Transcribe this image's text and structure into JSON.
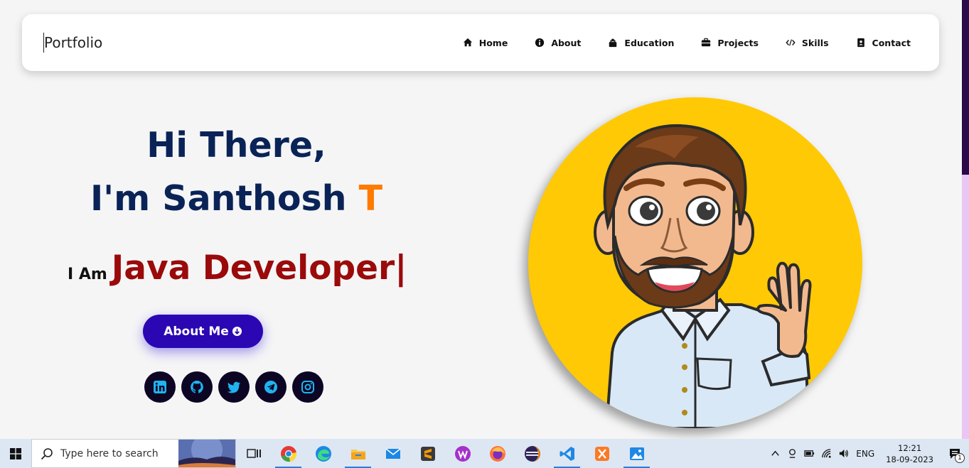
{
  "navbar": {
    "brand": "Portfolio",
    "items": [
      {
        "label": "Home",
        "icon": "home-icon"
      },
      {
        "label": "About",
        "icon": "info-icon"
      },
      {
        "label": "Education",
        "icon": "graduation-icon"
      },
      {
        "label": "Projects",
        "icon": "briefcase-icon"
      },
      {
        "label": "Skills",
        "icon": "code-icon"
      },
      {
        "label": "Contact",
        "icon": "address-book-icon"
      }
    ]
  },
  "hero": {
    "line1": "Hi There,",
    "line2_prefix": "I'm Santhosh ",
    "line2_accent": "T",
    "iam_label": "I Am",
    "iam_role": "Java Developer|",
    "about_button": "About Me",
    "socials": [
      "linkedin-icon",
      "github-icon",
      "twitter-icon",
      "telegram-icon",
      "instagram-icon"
    ]
  },
  "colors": {
    "heading": "#0a2357",
    "accent": "#ff7a00",
    "role": "#9b0a0a",
    "button": "#2a07b3",
    "avatar_bg": "#ffc905"
  },
  "taskbar": {
    "search_placeholder": "Type here to search",
    "apps": [
      "task-view-icon",
      "chrome-icon",
      "edge-icon",
      "file-explorer-icon",
      "mail-icon",
      "sublime-icon",
      "wps-icon",
      "firefox-icon",
      "eclipse-icon",
      "vscode-icon",
      "xampp-icon",
      "photos-icon"
    ],
    "language": "ENG",
    "time": "12:21",
    "date": "18-09-2023",
    "notification_count": "1"
  }
}
